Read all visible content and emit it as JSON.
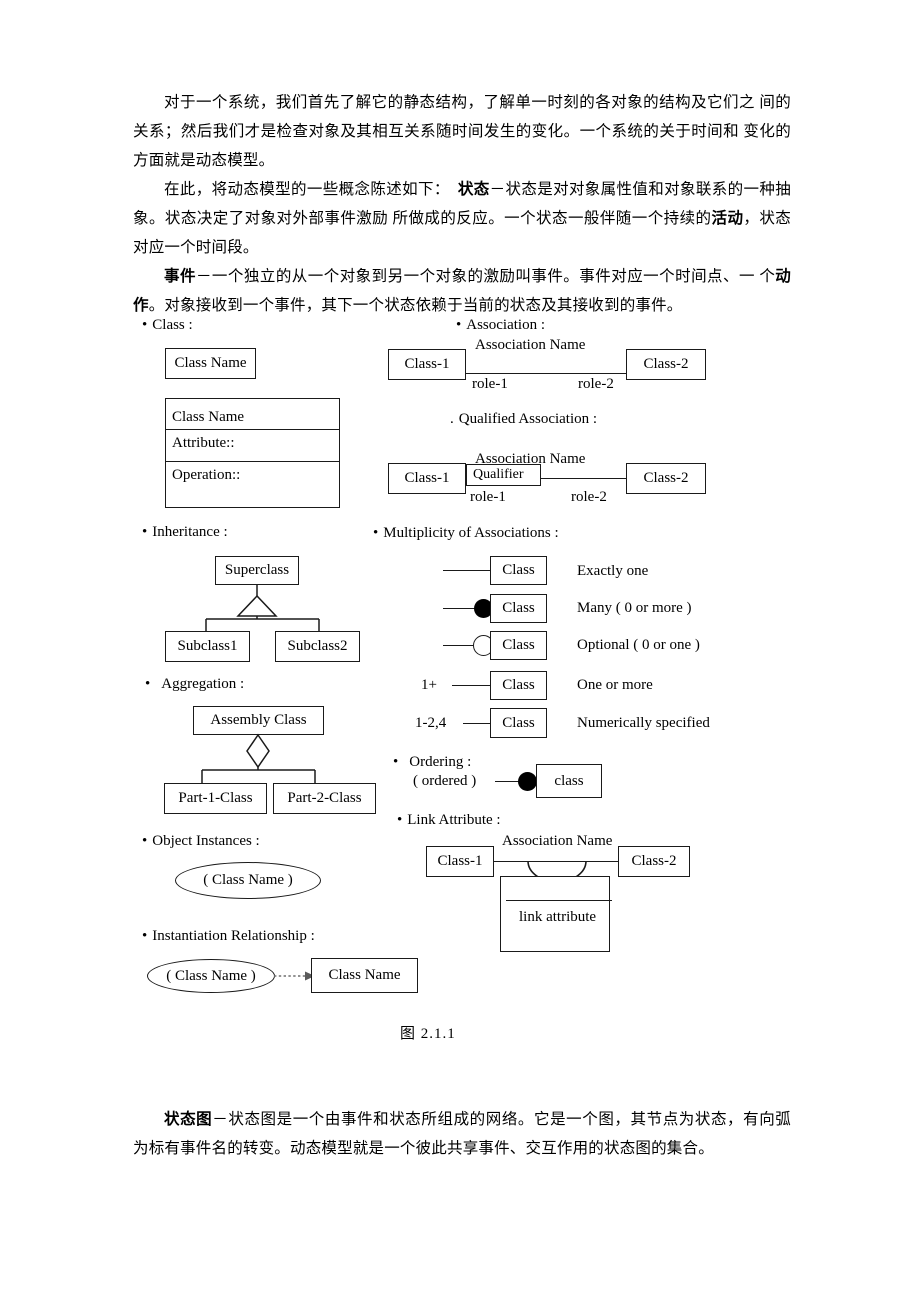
{
  "document": {
    "paragraphs": [
      "对于一个系统，我们首先了解它的静态结构，了解单一时刻的各对象的结构及它们之 间的关系；然后我们才是检查对象及其相互关系随时间发生的变化。一个系统的关于时间和 变化的方面就是动态模型。",
      "在此，将动态模型的一些概念陈述如下：",
      "。状态决定了对象对外部事件激励 所做成的反应。一个状态一般伴随一个持续的",
      "，状态对应一个时间段。",
      "。对象接收到一个事件，其下一个状态依赖于当前的状态及其接收到的事件。"
    ],
    "para1": "对于一个系统，我们首先了解它的静态结构，了解单一时刻的各对象的结构及它们之 间的关系；然后我们才是检查对象及其相互关系随时间发生的变化。一个系统的关于时间和 变化的方面就是动态模型。",
    "para2_lead": "在此，将动态模型的一些概念陈述如下：　",
    "para2_term": "状态",
    "para2_body_a": "－状态是对对象属性值和对象联系的一种抽象。状态决定了对象对外部事件激励 所做成的反应。一个状态一般伴随一个持续的",
    "para2_emph": "活动",
    "para2_body_b": "，状态对应一个时间段。",
    "para3_term": "事件",
    "para3_body_a": "－一个独立的从一个对象到另一个对象的激励叫事件。事件对应一个时间点、一 个",
    "para3_emph": "动作",
    "para3_body_b": "。对象接收到一个事件，其下一个状态依赖于当前的状态及其接收到的事件。",
    "para4_term": "状态图",
    "para4_body": "－状态图是一个由事件和状态所组成的网络。它是一个图，其节点为状态，有向弧为标有事件名的转变。动态模型就是一个彼此共享事件、交互作用的状态图的集合。",
    "figure_caption": "图 2.1.1"
  },
  "figure": {
    "sections": {
      "class": "Class :",
      "association": "Association :",
      "qualified_association": "Qualified Association :",
      "inheritance": "Inheritance :",
      "multiplicity": "Multiplicity of Associations :",
      "aggregation": "Aggregation :",
      "ordering": "Ordering :",
      "link_attribute": "Link Attribute :",
      "object_instances": "Object Instances :",
      "instantiation": "Instantiation Relationship :"
    },
    "class_simple": {
      "name": "Class Name"
    },
    "class_full": {
      "name": "Class Name",
      "attribute": "Attribute::",
      "operation": "Operation::"
    },
    "association": {
      "left": "Class-1",
      "right": "Class-2",
      "name": "Association Name",
      "role_left": "role-1",
      "role_right": "role-2"
    },
    "qualified_association": {
      "left": "Class-1",
      "right": "Class-2",
      "name": "Association Name",
      "qualifier": "Qualifier",
      "role_left": "role-1",
      "role_right": "role-2"
    },
    "inheritance": {
      "super": "Superclass",
      "sub1": "Subclass1",
      "sub2": "Subclass2"
    },
    "multiplicity_rows": [
      {
        "adornment": "none",
        "prefix": "",
        "box": "Class",
        "description": "Exactly one"
      },
      {
        "adornment": "filled-dot",
        "prefix": "",
        "box": "Class",
        "description": "Many ( 0 or more )"
      },
      {
        "adornment": "hollow-dot",
        "prefix": "",
        "box": "Class",
        "description": "Optional ( 0 or one )"
      },
      {
        "adornment": "none",
        "prefix": "1+",
        "box": "Class",
        "description": "One or more"
      },
      {
        "adornment": "none",
        "prefix": "1-2,4",
        "box": "Class",
        "description": "Numerically specified"
      }
    ],
    "aggregation": {
      "assembly": "Assembly Class",
      "part1": "Part-1-Class",
      "part2": "Part-2-Class"
    },
    "ordering": {
      "label": "( ordered )",
      "box": "class"
    },
    "link_attribute": {
      "left": "Class-1",
      "right": "Class-2",
      "name": "Association Name",
      "attribute": "link attribute"
    },
    "object_instances": {
      "ellipse": "( Class Name )"
    },
    "instantiation": {
      "ellipse": "( Class Name )",
      "box": "Class Name"
    }
  },
  "colors": {
    "ink": "#1a1a1a",
    "page": "#ffffff"
  }
}
